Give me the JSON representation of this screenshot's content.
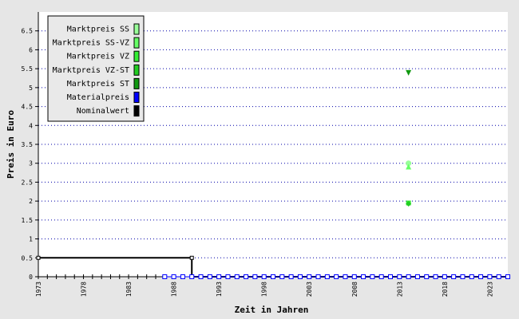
{
  "chart_data": {
    "type": "line",
    "xlabel": "Zeit in Jahren",
    "ylabel": "Preis in Euro",
    "xlim": [
      1973,
      2025
    ],
    "ylim": [
      0,
      7
    ],
    "x_ticks": [
      "1973",
      "1978",
      "1983",
      "1988",
      "1993",
      "1998",
      "2003",
      "2008",
      "2013",
      "2018",
      "2023"
    ],
    "y_ticks": [
      "0",
      "0.5",
      "1",
      "1.5",
      "2",
      "2.5",
      "3",
      "3.5",
      "4",
      "4.5",
      "5",
      "5.5",
      "6",
      "6.5"
    ],
    "grid": "horizontal-dotted",
    "legend_position": "top-left",
    "legend": [
      {
        "label": "Marktpreis SS",
        "color": "#99ff99"
      },
      {
        "label": "Marktpreis SS-VZ",
        "color": "#66ff66"
      },
      {
        "label": "Marktpreis VZ",
        "color": "#33ee33"
      },
      {
        "label": "Marktpreis VZ-ST",
        "color": "#22cc22"
      },
      {
        "label": "Marktpreis ST",
        "color": "#119911"
      },
      {
        "label": "Materialpreis",
        "color": "#0000ff"
      },
      {
        "label": "Nominalwert",
        "color": "#000000"
      }
    ],
    "series": [
      {
        "name": "Nominalwert",
        "color": "#000000",
        "step": true,
        "x": [
          1973,
          1990,
          1990,
          2025
        ],
        "y": [
          0.5,
          0.5,
          0,
          0
        ]
      },
      {
        "name": "Materialpreis",
        "color": "#0000ff",
        "x": [
          1987,
          1988,
          1989,
          1990,
          1991,
          1992,
          1993,
          1994,
          1995,
          1996,
          1997,
          1998,
          1999,
          2000,
          2001,
          2002,
          2003,
          2004,
          2005,
          2006,
          2007,
          2008,
          2009,
          2010,
          2011,
          2012,
          2013,
          2014,
          2015,
          2016,
          2017,
          2018,
          2019,
          2020,
          2021,
          2022,
          2023,
          2024,
          2025
        ],
        "y": [
          0,
          0,
          0,
          0,
          0,
          0,
          0,
          0,
          0,
          0,
          0,
          0,
          0,
          0,
          0,
          0,
          0,
          0,
          0,
          0,
          0,
          0,
          0,
          0,
          0,
          0,
          0,
          0,
          0,
          0,
          0,
          0,
          0,
          0,
          0,
          0,
          0,
          0,
          0
        ]
      },
      {
        "name": "Marktpreis SS",
        "color": "#99ff99",
        "x": [
          2014
        ],
        "y": [
          3.0
        ]
      },
      {
        "name": "Marktpreis SS-VZ",
        "color": "#66ff66",
        "x": [
          2014
        ],
        "y": [
          2.9
        ]
      },
      {
        "name": "Marktpreis VZ",
        "color": "#33ee33",
        "x": [
          2014
        ],
        "y": [
          1.95
        ]
      },
      {
        "name": "Marktpreis VZ-ST",
        "color": "#22cc22",
        "x": [
          2014
        ],
        "y": [
          1.93
        ]
      },
      {
        "name": "Marktpreis ST",
        "color": "#119911",
        "x": [
          2014
        ],
        "y": [
          5.4
        ]
      }
    ]
  }
}
